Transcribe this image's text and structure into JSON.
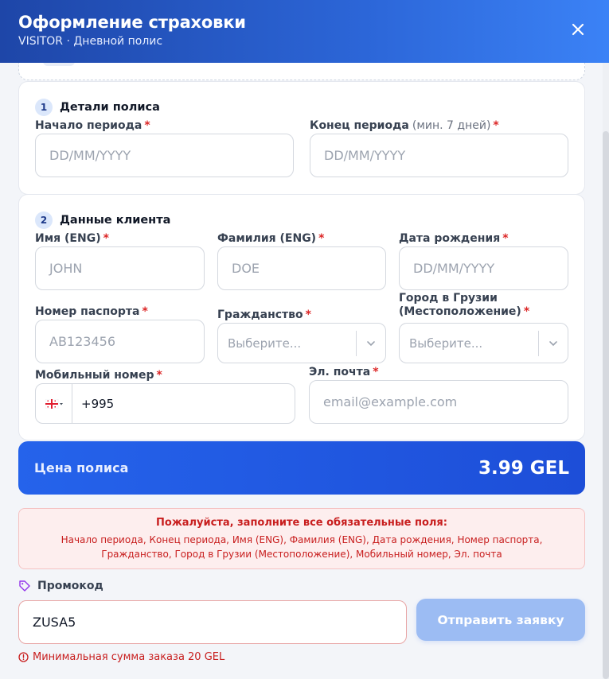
{
  "header": {
    "title": "Оформление страховки",
    "subtitle": "VISITOR · Дневной полис"
  },
  "section1": {
    "number": "1",
    "title": "Детали полиса",
    "start_label": "Начало периода",
    "start_placeholder": "DD/MM/YYYY",
    "end_label": "Конец периода",
    "end_hint": "(мин. 7 дней)",
    "end_placeholder": "DD/MM/YYYY"
  },
  "section2": {
    "number": "2",
    "title": "Данные клиента",
    "first_name_label": "Имя (ENG)",
    "first_name_placeholder": "JOHN",
    "last_name_label": "Фамилия (ENG)",
    "last_name_placeholder": "DOE",
    "dob_label": "Дата рождения",
    "dob_placeholder": "DD/MM/YYYY",
    "passport_label": "Номер паспорта",
    "passport_placeholder": "AB123456",
    "citizenship_label": "Гражданство",
    "citizenship_value": "Выберите...",
    "city_label_line1": "Город в Грузии",
    "city_label_line2": "(Местоположение)",
    "city_value": "Выберите...",
    "phone_label": "Мобильный номер",
    "phone_value": "+995",
    "email_label": "Эл. почта",
    "email_placeholder": "email@example.com",
    "required_mark": "*"
  },
  "price": {
    "label": "Цена полиса",
    "value": "3.99 GEL"
  },
  "error": {
    "title": "Пожалуйста, заполните все обязательные поля:",
    "list": "Начало периода, Конец периода, Имя (ENG), Фамилия (ENG), Дата рождения, Номер паспорта, Гражданство, Город в Грузии (Местоположение), Мобильный номер, Эл. почта"
  },
  "promo": {
    "label": "Промокод",
    "value": "ZUSA5",
    "submit_label": "Отправить заявку",
    "error_text": "Минимальная сумма заказа 20 GEL"
  },
  "colors": {
    "header_start": "#1e46a8",
    "header_end": "#3b82f6",
    "accent": "#2563eb",
    "required": "#dc2626",
    "error": "#c81e1e",
    "submit_disabled": "#9cbcf3"
  },
  "icons": {
    "close": "close-icon",
    "chevron": "chevron-down-icon",
    "flag": "georgia-flag-icon",
    "tag": "tag-icon",
    "alert": "alert-circle-icon"
  }
}
